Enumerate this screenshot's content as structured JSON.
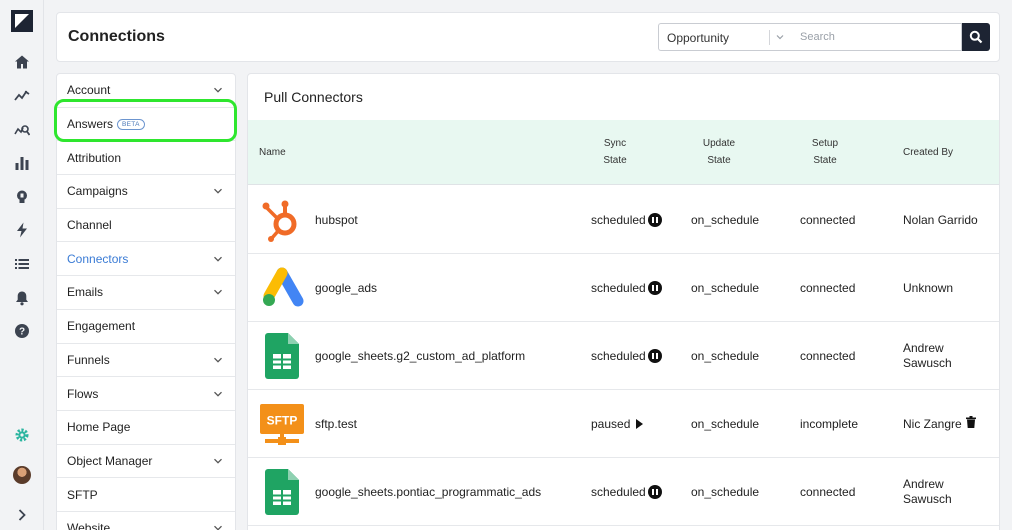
{
  "header": {
    "title": "Connections",
    "filter_selected": "Opportunity",
    "search_placeholder": "Search"
  },
  "menu": {
    "items": [
      {
        "label": "Account",
        "chevron": true
      },
      {
        "label": "Answers",
        "badge": "BETA",
        "chevron": false
      },
      {
        "label": "Attribution",
        "chevron": false
      },
      {
        "label": "Campaigns",
        "chevron": true
      },
      {
        "label": "Channel",
        "chevron": false
      },
      {
        "label": "Connectors",
        "chevron": true,
        "active": true
      },
      {
        "label": "Emails",
        "chevron": true
      },
      {
        "label": "Engagement",
        "chevron": false
      },
      {
        "label": "Funnels",
        "chevron": true
      },
      {
        "label": "Flows",
        "chevron": true
      },
      {
        "label": "Home Page",
        "chevron": false
      },
      {
        "label": "Object Manager",
        "chevron": true
      },
      {
        "label": "SFTP",
        "chevron": false
      },
      {
        "label": "Website",
        "chevron": true
      }
    ]
  },
  "main": {
    "section_title": "Pull Connectors",
    "columns": {
      "name": "Name",
      "sync_1": "Sync",
      "sync_2": "State",
      "update_1": "Update",
      "update_2": "State",
      "setup_1": "Setup",
      "setup_2": "State",
      "created_by": "Created By"
    },
    "rows": [
      {
        "icon": "hubspot-logo-icon",
        "name": "hubspot",
        "sync": "scheduled",
        "sync_icon": "pause-icon",
        "update": "on_schedule",
        "setup": "connected",
        "by_1": "Nolan Garrido",
        "by_2": ""
      },
      {
        "icon": "google-ads-logo-icon",
        "name": "google_ads",
        "sync": "scheduled",
        "sync_icon": "pause-icon",
        "update": "on_schedule",
        "setup": "connected",
        "by_1": "Unknown",
        "by_2": ""
      },
      {
        "icon": "google-sheets-logo-icon",
        "name": "google_sheets.g2_custom_ad_platform",
        "sync": "scheduled",
        "sync_icon": "pause-icon",
        "update": "on_schedule",
        "setup": "connected",
        "by_1": "Andrew",
        "by_2": "Sawusch"
      },
      {
        "icon": "sftp-logo-icon",
        "name": "sftp.test",
        "sync": "paused",
        "sync_icon": "play-icon",
        "update": "on_schedule",
        "setup": "incomplete",
        "by_1": "Nic Zangre",
        "by_2": "",
        "trash": true
      },
      {
        "icon": "google-sheets-logo-icon",
        "name": "google_sheets.pontiac_programmatic_ads",
        "sync": "scheduled",
        "sync_icon": "pause-icon",
        "update": "on_schedule",
        "setup": "connected",
        "by_1": "Andrew",
        "by_2": "Sawusch"
      }
    ]
  },
  "sftp_logo_text": "SFTP",
  "colors": {
    "accent": "#3a7bd5",
    "dark": "#1d2433",
    "highlight": "#2ee62e",
    "table_header_bg": "#e8f8f1",
    "settings_icon": "#2bb5a0"
  }
}
